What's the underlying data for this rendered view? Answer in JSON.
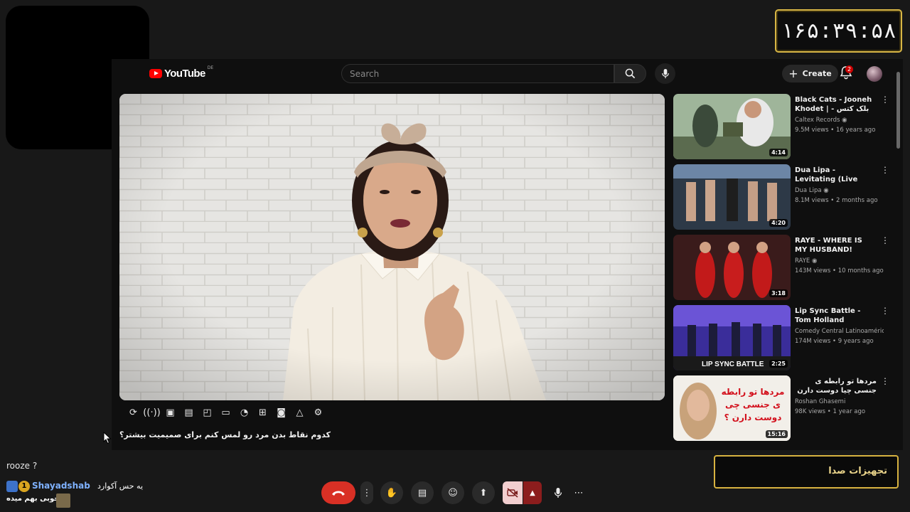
{
  "timer": "۱۶۵:۳۹:۵۸",
  "youtube": {
    "logo_text": "YouTube",
    "region": "DE",
    "search_placeholder": "Search",
    "create_label": "Create",
    "notifications_count": "2"
  },
  "video": {
    "title": "کدوم نقاط بدن مرد رو لمس کنم برای صمیمیت بیشتر؟"
  },
  "recommendations": [
    {
      "title": "Black Cats - Jooneh Khodet | بلک کتس - جون ...",
      "channel": "Caltex Records",
      "views": "9.5M views",
      "age": "16 years ago",
      "duration": "4:14",
      "verified": true
    },
    {
      "title": "Dua Lipa - Levitating (Live From Mexico)",
      "channel": "Dua Lipa",
      "views": "8.1M views",
      "age": "2 months ago",
      "duration": "4:20",
      "verified": true
    },
    {
      "title": "RAYE - WHERE IS MY HUSBAND! (Official ...",
      "channel": "RAYE",
      "views": "143M views",
      "age": "10 months ago",
      "duration": "3:18",
      "verified": true
    },
    {
      "title": "Lip Sync Battle - Tom Holland",
      "channel": "Comedy Central Latinoamérica",
      "views": "174M views",
      "age": "9 years ago",
      "duration": "2:25",
      "verified": true,
      "thumb_text": "LIP SYNC BATTLE"
    },
    {
      "title": "مردها تو رابطه ی جنسی چیا دوست دارن ؟",
      "channel": "Roshan Ghasemi",
      "views": "98K views",
      "age": "1 year ago",
      "duration": "15:16",
      "verified": false,
      "thumb_text": "مردها تو رابطه ی جنسی چی دوست دارن ؟"
    }
  ],
  "chat": {
    "line1": "rooze ?",
    "user": "Shayadshab",
    "badge": "1",
    "message1": "یه حس آکوارد",
    "message2": "خوبی بهم میده"
  },
  "audio_widget": {
    "label": "تجهیزات صدا"
  }
}
